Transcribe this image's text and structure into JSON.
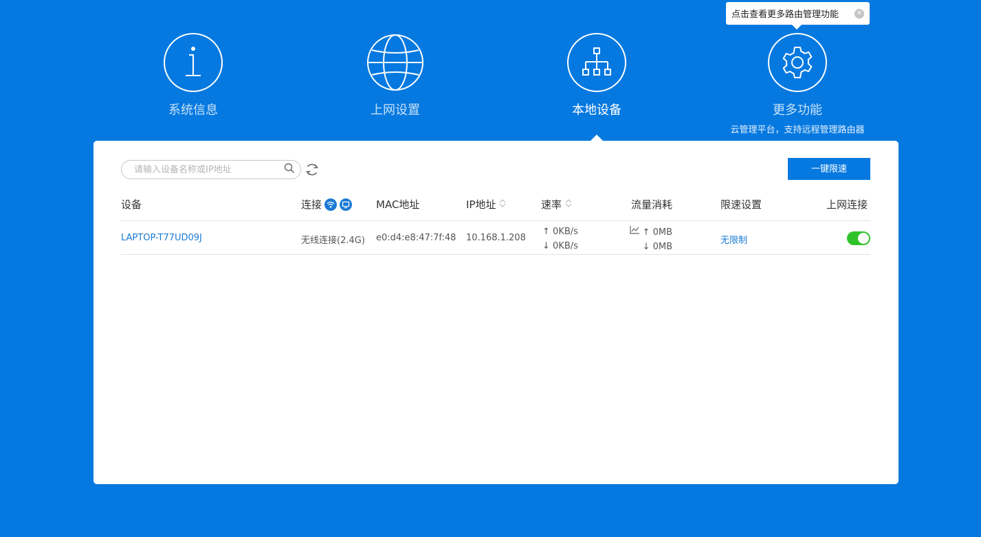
{
  "tooltip": {
    "text": "点击查看更多路由管理功能",
    "close_icon": "close-circle-icon"
  },
  "nav": [
    {
      "label": "系统信息",
      "icon": "info-icon"
    },
    {
      "label": "上网设置",
      "icon": "globe-icon"
    },
    {
      "label": "本地设备",
      "icon": "network-topology-icon",
      "active": true
    },
    {
      "label": "更多功能",
      "icon": "gear-icon",
      "sub": "云管理平台，支持远程管理路由器"
    }
  ],
  "search": {
    "placeholder": "请输入设备名称或IP地址",
    "value": ""
  },
  "limit_button": "一键限速",
  "headers": {
    "device": "设备",
    "connection": "连接",
    "mac": "MAC地址",
    "ip": "IP地址",
    "rate": "速率",
    "traffic": "流量消耗",
    "limit": "限速设置",
    "online": "上网连接"
  },
  "rows": [
    {
      "device": "LAPTOP-T77UD09J",
      "connection": "无线连接(2.4G)",
      "mac": "e0:d4:e8:47:7f:48",
      "ip": "10.168.1.208",
      "rate_up": "0KB/s",
      "rate_down": "0KB/s",
      "traffic_up": "0MB",
      "traffic_down": "0MB",
      "limit": "无限制",
      "online": true
    }
  ],
  "colors": {
    "background": "#0679e0",
    "accent": "#1a7ad4",
    "toggle_on": "#2fc32a"
  }
}
